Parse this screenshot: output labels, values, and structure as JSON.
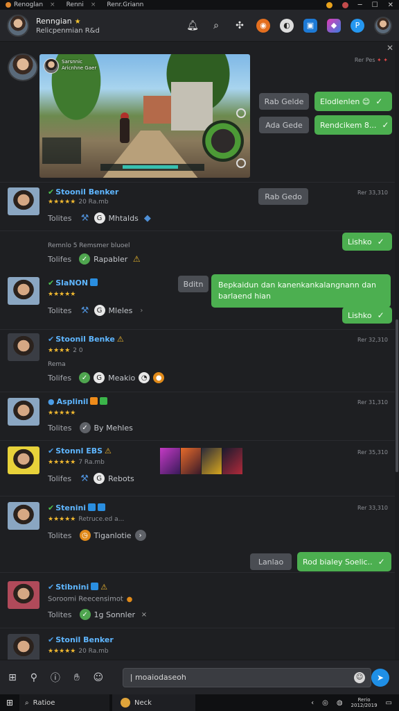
{
  "tabs": [
    {
      "label": "Renoglan",
      "close": "×"
    },
    {
      "label": "Renni",
      "close": "×"
    },
    {
      "label": "Renr.Griann",
      "close": ""
    }
  ],
  "window_controls": {
    "minimize": "─",
    "maximize": "☐",
    "close": "✕"
  },
  "header": {
    "title": "Renngian",
    "subtitle": "Relicpenmian  R&d"
  },
  "chat": {
    "close": "✕",
    "first": {
      "time": "Rer Pes",
      "preview_caption_line1": "Sarsnnic",
      "preview_caption_line2": "Aricnhne Gaer",
      "bubbles_gray": [
        "Rab Gelde",
        "Ada Gede"
      ],
      "bubbles_green": [
        "Elodlenlen 😊",
        "Rendcikem 8..."
      ]
    },
    "rows": [
      {
        "name": "Stoonil Benker",
        "rating_rest": "20 Ra.mb",
        "label": "Tolites",
        "text": "Mhtalds",
        "time": "Rer 33,310",
        "bubble_gray": "Rab Gedo"
      },
      {
        "note": "Remnlo 5 Remsmer bluoel",
        "label": "Tolifes",
        "text": "Rapabler",
        "bubble_green": "Lishko"
      },
      {
        "name": "SlaNON",
        "label": "Tolites",
        "text": "Mleles",
        "bubble_gray": "Bditn",
        "bubble_long": "Bepkaidun dan kanenkankalangnann dan barlaend hian",
        "bubble_green": "Lishko"
      },
      {
        "name": "Stoonil Benke",
        "rating_rest": "2 0",
        "note": "Rema",
        "label": "Tolifes",
        "text": "Meakio",
        "time": "Rer 32,310"
      },
      {
        "name": "Asplinil",
        "label": "Tolites",
        "text": "By Mehles",
        "time": "Rer 31,310"
      },
      {
        "name": "Stonnl EBS",
        "rating_rest": "7 Ra.mb",
        "label": "Tolifes",
        "text": "Rebots",
        "time": "Rer 35,310"
      },
      {
        "name": "Stenini",
        "rating_rest": "Retruce.ed a...",
        "label": "Tolites",
        "text": "Tiganlotie",
        "time": "Rer 33,310",
        "bubble_gray": "Lanlao",
        "bubble_green": "Rod bialey Soelic.."
      },
      {
        "name": "Stibnini",
        "note": "Soroomi  Reecensimot",
        "label": "Tolites",
        "text": "1g Sonnler",
        "time": ""
      },
      {
        "name": "Stonil Benker",
        "rating_rest": "20 Ra.mb"
      }
    ]
  },
  "composer": {
    "placeholder": "| moaiodaseoh"
  },
  "taskbar": {
    "search_label": "Ratioe",
    "app_label": "Neck",
    "clock_line1": "Rerio",
    "clock_line2": "2012/2019"
  },
  "colors": {
    "accent_green": "#4caf50",
    "accent_blue": "#2597f0",
    "name_blue": "#5fb6ff",
    "background": "#1e1f22"
  },
  "icons": [
    "bell-icon",
    "search-icon",
    "puzzle-icon",
    "orange-app-icon",
    "compass-icon",
    "blue-app-icon",
    "gradient-app-icon",
    "paypal-icon"
  ]
}
